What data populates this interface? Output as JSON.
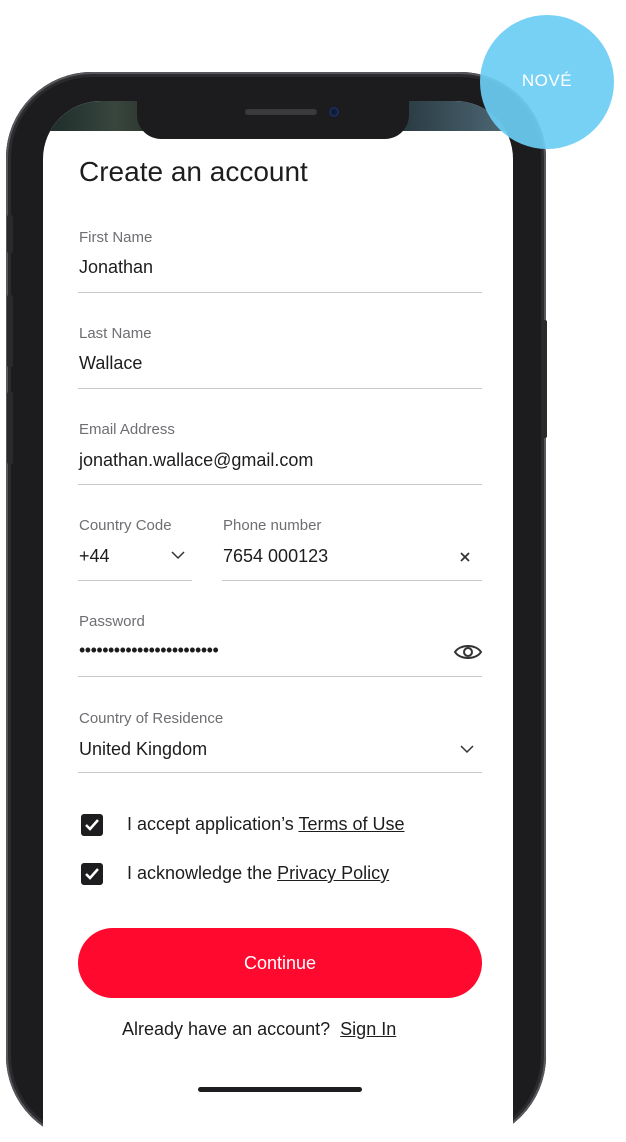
{
  "badge": {
    "label": "NOVÉ"
  },
  "form": {
    "title": "Create an account",
    "first_name": {
      "label": "First Name",
      "value": "Jonathan"
    },
    "last_name": {
      "label": "Last Name",
      "value": "Wallace"
    },
    "email": {
      "label": "Email Address",
      "value": "jonathan.wallace@gmail.com"
    },
    "country_code": {
      "label": "Country Code",
      "value": "+44"
    },
    "phone": {
      "label": "Phone number",
      "value": "7654 000123"
    },
    "password": {
      "label": "Password",
      "masked": "••••••••••••••••••••••••"
    },
    "residence": {
      "label": "Country of Residence",
      "value": "United Kingdom"
    },
    "terms": {
      "prefix": "I accept application’s ",
      "link": "Terms of Use",
      "checked": true
    },
    "privacy": {
      "prefix": "I acknowledge the ",
      "link": "Privacy Policy",
      "checked": true
    },
    "continue_label": "Continue",
    "signin": {
      "prompt": "Already have an account?",
      "link": "Sign In"
    }
  },
  "colors": {
    "accent": "#ff0a2e",
    "badge": "#6bcdf3",
    "text": "#1d1d1f",
    "label": "#6e6e73"
  },
  "icons": {
    "country_code_chevron": "chevron-down-icon",
    "phone_clear": "close-icon",
    "password_toggle": "eye-icon",
    "residence_chevron": "chevron-down-icon",
    "checkbox": "checkmark-icon"
  }
}
